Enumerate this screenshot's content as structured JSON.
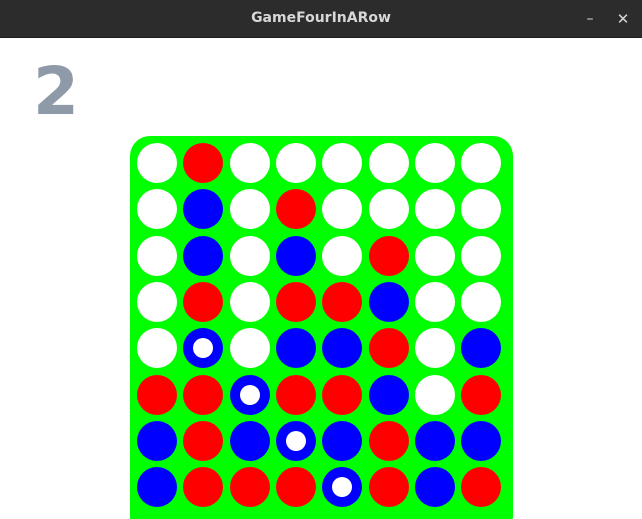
{
  "window": {
    "title": "GameFourInARow",
    "minimize_glyph": "–",
    "close_glyph": "✕"
  },
  "game": {
    "counter": "2",
    "colors": {
      "board": "#00ff00",
      "red": "#ff0000",
      "blue": "#0000ff",
      "empty": "#ffffff",
      "counter": "#8e9aa8"
    },
    "board": [
      [
        "empty",
        "red",
        "empty",
        "empty",
        "empty",
        "empty",
        "empty",
        "empty"
      ],
      [
        "empty",
        "blue",
        "empty",
        "red",
        "empty",
        "empty",
        "empty",
        "empty"
      ],
      [
        "empty",
        "blue",
        "empty",
        "blue",
        "empty",
        "red",
        "empty",
        "empty"
      ],
      [
        "empty",
        "red",
        "empty",
        "red",
        "red",
        "blue",
        "empty",
        "empty"
      ],
      [
        "empty",
        "blue*",
        "empty",
        "blue",
        "blue",
        "red",
        "empty",
        "blue"
      ],
      [
        "red",
        "red",
        "blue*",
        "red",
        "red",
        "blue",
        "empty",
        "red"
      ],
      [
        "blue",
        "red",
        "blue",
        "blue*",
        "blue",
        "red",
        "blue",
        "blue"
      ],
      [
        "blue",
        "red",
        "red",
        "red",
        "blue*",
        "red",
        "blue",
        "red"
      ]
    ]
  }
}
